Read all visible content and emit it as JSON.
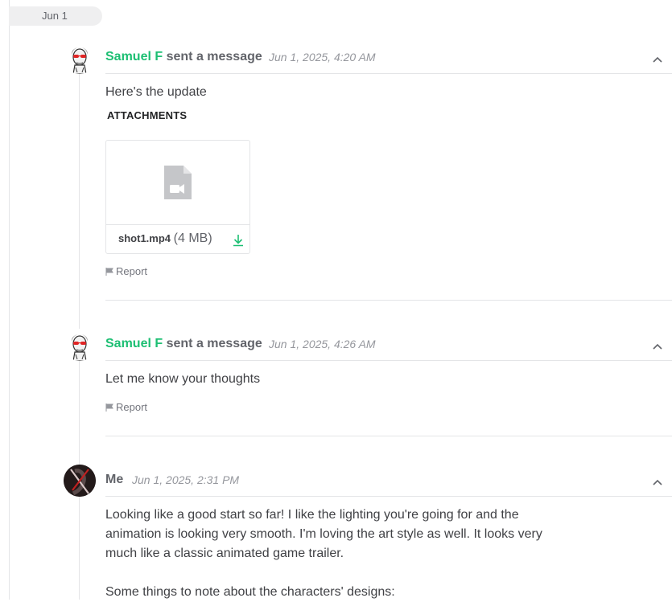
{
  "date_separator": "Jun 1",
  "colors": {
    "accent_green": "#1dbf73",
    "muted_gray": "#95979d",
    "text": "#404145"
  },
  "messages": [
    {
      "sender": "Samuel F",
      "verb": "sent a message",
      "time": "Jun 1, 2025, 4:20 AM",
      "lines": [
        "Here's the update"
      ],
      "attachments_title": "ATTACHMENTS",
      "attachment": {
        "name": "shot1.mp4",
        "size": "(4 MB)",
        "icon": "video-file-icon"
      },
      "report": "Report"
    },
    {
      "sender": "Samuel F",
      "verb": "sent a message",
      "time": "Jun 1, 2025, 4:26 AM",
      "lines": [
        "Let me know your thoughts"
      ],
      "report": "Report"
    },
    {
      "sender": "Me",
      "time": "Jun 1, 2025, 2:31 PM",
      "lines": [
        "Looking like a good start so far! I like the lighting you're going for and the",
        "animation is looking very smooth. I'm loving the art style as well. It looks very",
        "much like a classic animated game trailer.",
        "",
        "Some things to note about the characters' designs:"
      ]
    }
  ]
}
